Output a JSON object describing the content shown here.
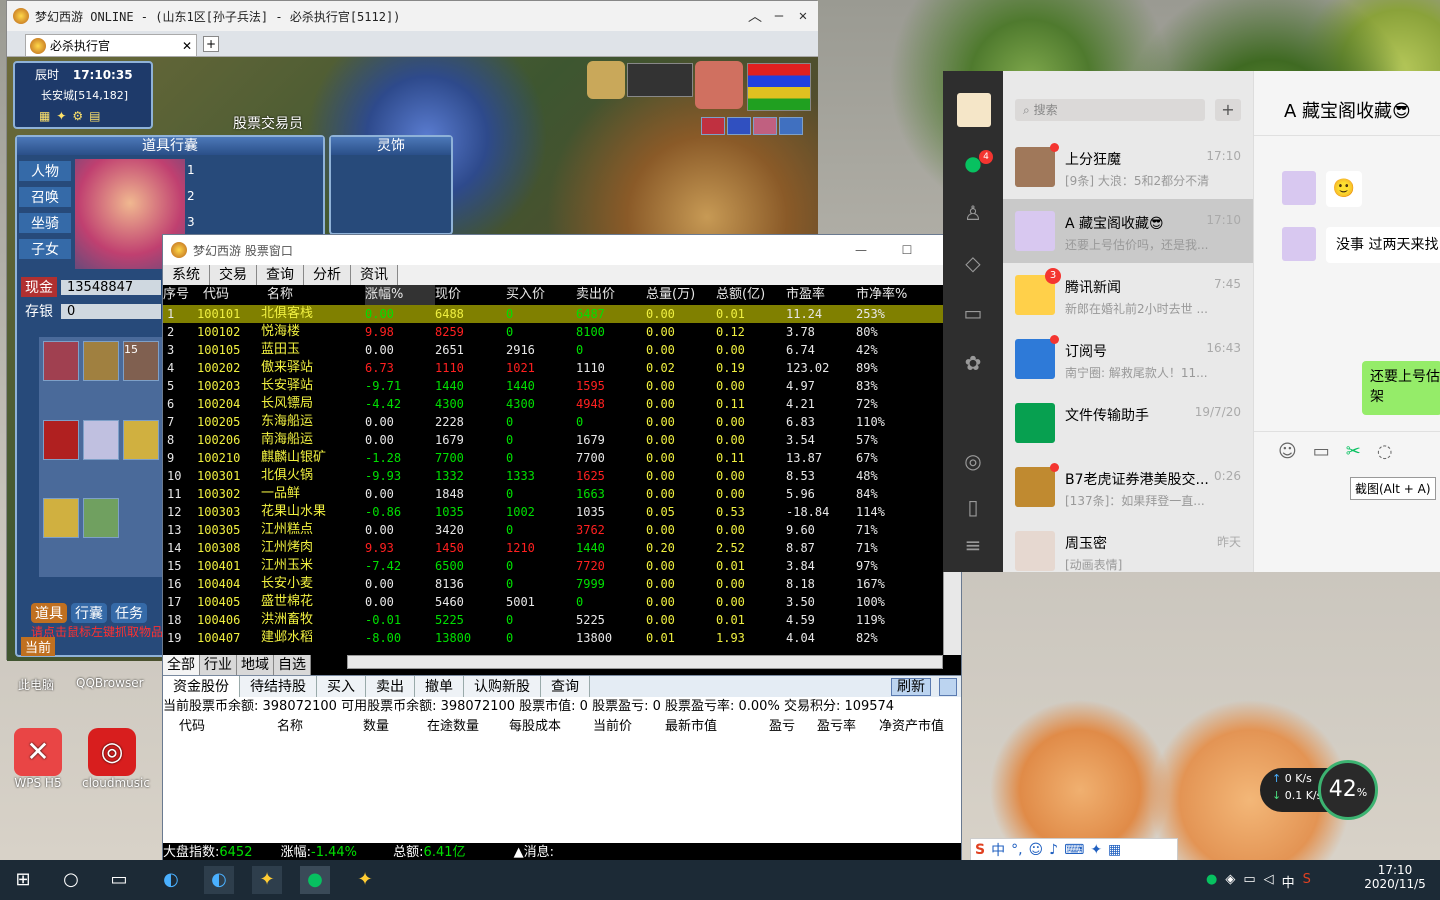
{
  "game": {
    "title": "梦幻西游 ONLINE - (山东1区[孙子兵法] - 必杀执行官[5112])",
    "tab_label": "必杀执行官",
    "clock_label": "辰时",
    "clock_time": "17:10:35",
    "location": "长安城[514,182]",
    "npc_label": "股票交易员",
    "bag_title": "道具行囊",
    "spirit_title": "灵饰",
    "side_tabs": [
      "人物",
      "召唤",
      "坐骑",
      "子女"
    ],
    "cash_label": "现金",
    "cash_value": "13548847",
    "deposit_label": "存银",
    "deposit_value": "0",
    "item_count": "15",
    "bottom_tabs": [
      "道具",
      "行囊",
      "任务"
    ],
    "hint": "请点击鼠标左键抓取物品",
    "current_label": "当前",
    "slot_numbers": [
      "1",
      "2",
      "3"
    ]
  },
  "stock": {
    "title": "梦幻西游 股票窗口",
    "menu": [
      "系统",
      "交易",
      "查询",
      "分析",
      "资讯"
    ],
    "headers": [
      "序号",
      "代码",
      "名称",
      "涨幅%",
      "现价",
      "买入价",
      "卖出价",
      "总量(万)",
      "总额(亿)",
      "市盈率",
      "市净率%"
    ],
    "rows": [
      [
        "1",
        "100101",
        "北俱客栈",
        "0.00",
        "6488",
        "0",
        "6487",
        "0.00",
        "0.01",
        "11.24",
        "253%"
      ],
      [
        "2",
        "100102",
        "悦海楼",
        "9.98",
        "8259",
        "0",
        "8100",
        "0.00",
        "0.12",
        "3.78",
        "80%"
      ],
      [
        "3",
        "100105",
        "蓝田玉",
        "0.00",
        "2651",
        "2916",
        "0",
        "0.00",
        "0.00",
        "6.74",
        "42%"
      ],
      [
        "4",
        "100202",
        "傲来驿站",
        "6.73",
        "1110",
        "1021",
        "1110",
        "0.02",
        "0.19",
        "123.02",
        "89%"
      ],
      [
        "5",
        "100203",
        "长安驿站",
        "-9.71",
        "1440",
        "1440",
        "1595",
        "0.00",
        "0.00",
        "4.97",
        "83%"
      ],
      [
        "6",
        "100204",
        "长风镖局",
        "-4.42",
        "4300",
        "4300",
        "4948",
        "0.00",
        "0.11",
        "4.21",
        "72%"
      ],
      [
        "7",
        "100205",
        "东海船运",
        "0.00",
        "2228",
        "0",
        "0",
        "0.00",
        "0.00",
        "6.83",
        "110%"
      ],
      [
        "8",
        "100206",
        "南海船运",
        "0.00",
        "1679",
        "0",
        "1679",
        "0.00",
        "0.00",
        "3.54",
        "57%"
      ],
      [
        "9",
        "100210",
        "麒麟山银矿",
        "-1.28",
        "7700",
        "0",
        "7700",
        "0.00",
        "0.11",
        "13.87",
        "67%"
      ],
      [
        "10",
        "100301",
        "北俱火锅",
        "-9.93",
        "1332",
        "1333",
        "1625",
        "0.00",
        "0.00",
        "8.53",
        "48%"
      ],
      [
        "11",
        "100302",
        "一品鲜",
        "0.00",
        "1848",
        "0",
        "1663",
        "0.00",
        "0.00",
        "5.96",
        "84%"
      ],
      [
        "12",
        "100303",
        "花果山水果",
        "-0.86",
        "1035",
        "1002",
        "1035",
        "0.05",
        "0.53",
        "-18.84",
        "114%"
      ],
      [
        "13",
        "100305",
        "江州糕点",
        "0.00",
        "3420",
        "0",
        "3762",
        "0.00",
        "0.00",
        "9.60",
        "71%"
      ],
      [
        "14",
        "100308",
        "江州烤肉",
        "9.93",
        "1450",
        "1210",
        "1440",
        "0.20",
        "2.52",
        "8.87",
        "71%"
      ],
      [
        "15",
        "100401",
        "江州玉米",
        "-7.42",
        "6500",
        "0",
        "7720",
        "0.00",
        "0.01",
        "3.84",
        "97%"
      ],
      [
        "16",
        "100404",
        "长安小麦",
        "0.00",
        "8136",
        "0",
        "7999",
        "0.00",
        "0.00",
        "8.18",
        "167%"
      ],
      [
        "17",
        "100405",
        "盛世棉花",
        "0.00",
        "5460",
        "5001",
        "0",
        "0.00",
        "0.00",
        "3.50",
        "100%"
      ],
      [
        "18",
        "100406",
        "洪洲畜牧",
        "-0.01",
        "5225",
        "0",
        "5225",
        "0.00",
        "0.01",
        "4.59",
        "119%"
      ],
      [
        "19",
        "100407",
        "建邺水稻",
        "-8.00",
        "13800",
        "0",
        "13800",
        "0.01",
        "1.93",
        "4.04",
        "82%"
      ]
    ],
    "bottom_tabs": [
      "全部",
      "行业",
      "地域",
      "自选"
    ],
    "trade_buttons": [
      "资金股份",
      "待结持股",
      "买入",
      "卖出",
      "撤单",
      "认购新股",
      "查询"
    ],
    "refresh_label": "刷新",
    "account_line": "当前股票币余额: 398072100  可用股票币余额: 398072100  股票市值: 0  股票盈亏: 0  股票盈亏率: 0.00%  交易积分: 109574",
    "position_headers": [
      "代码",
      "名称",
      "数量",
      "在途数量",
      "每股成本",
      "当前价",
      "最新市值",
      "盈亏",
      "盈亏率",
      "净资产市值"
    ],
    "status": {
      "index_label": "大盘指数:",
      "index_value": "6452",
      "chg_label": "涨幅:",
      "chg_value": "-1.44%",
      "total_label": "总额:",
      "total_value": "6.41亿",
      "msg_label": "▲消息:"
    }
  },
  "wechat": {
    "search_placeholder": "搜索",
    "chat_title": "A 藏宝阁收藏😎",
    "chats": [
      {
        "name": "上分狂魔",
        "preview": "[9条] 大浪：5和2都分不清",
        "time": "17:10",
        "dot": true,
        "badge": ""
      },
      {
        "name": "A 藏宝阁收藏😎",
        "preview": "还要上号估价吗，还是我...",
        "time": "17:10",
        "dot": false,
        "badge": ""
      },
      {
        "name": "腾讯新闻",
        "preview": "新郎在婚礼前2小时去世 ...",
        "time": "7:45",
        "dot": false,
        "badge": "3"
      },
      {
        "name": "订阅号",
        "preview": "南宁圈: 解救尾款人！11...",
        "time": "16:43",
        "dot": true,
        "badge": ""
      },
      {
        "name": "文件传输助手",
        "preview": "",
        "time": "19/7/20",
        "dot": false,
        "badge": ""
      },
      {
        "name": "B7老虎证券港美股交...",
        "preview": "[137条]：如果拜登一直...",
        "time": "0:26",
        "dot": true,
        "badge": ""
      },
      {
        "name": "周玉密",
        "preview": "[动画表情]",
        "time": "昨天",
        "dot": false,
        "badge": ""
      }
    ],
    "side_badge": "4",
    "msg1": "🙂",
    "msg2": "没事 过两天来找",
    "msg3": "还要上号估价\n架",
    "screenshot_tip": "截图(Alt + A)"
  },
  "desktop": {
    "icons": [
      "此电脑",
      "QQBrowser",
      "WPS H5",
      "cloudmusic"
    ],
    "net_up": "0 K/s",
    "net_down": "0.1 K/s",
    "cpu": "42",
    "ime": "中"
  },
  "taskbar": {
    "time": "17:10",
    "date": "2020/11/5",
    "ime": "中"
  },
  "colors": {
    "up": "#ff2020",
    "down": "#00e000",
    "flat": "#e8e8e8",
    "selected_row": "#808000"
  }
}
